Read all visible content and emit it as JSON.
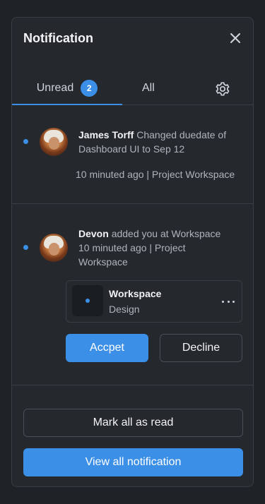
{
  "panel": {
    "title": "Notification",
    "tabs": {
      "unread_label": "Unread",
      "unread_count": "2",
      "all_label": "All"
    },
    "items": [
      {
        "user": "James Torff",
        "message": "Changed duedate of Dashboard UI to Sep 12",
        "meta": "10 minuted ago | Project Workspace"
      },
      {
        "user": "Devon",
        "message": "added you at Workspace",
        "meta": "10 minuted ago | Project Workspace",
        "card": {
          "title": "Workspace",
          "subtitle": "Design"
        },
        "accept_label": "Accpet",
        "decline_label": "Decline"
      }
    ],
    "mark_all_label": "Mark all as read",
    "view_all_label": "View all notification"
  },
  "colors": {
    "accent": "#3b8fe6",
    "panel_bg": "#25282d",
    "page_bg": "#1f2226",
    "border": "#3a3e44"
  },
  "icons": [
    "close-icon",
    "gear-icon",
    "more-icon"
  ]
}
